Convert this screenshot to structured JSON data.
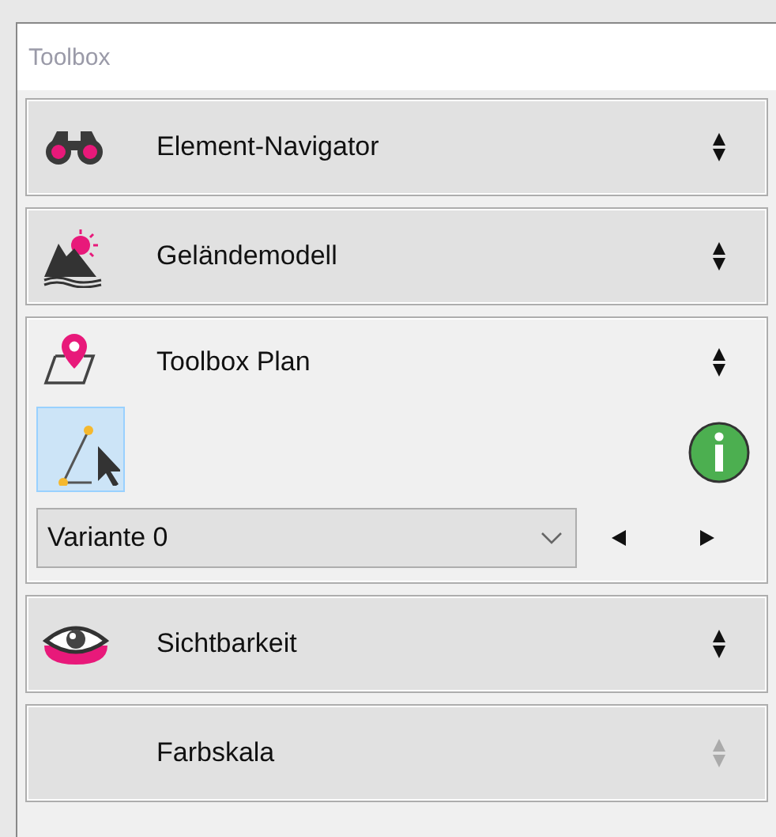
{
  "window": {
    "title": "Toolbox"
  },
  "panels": [
    {
      "title": "Element-Navigator",
      "expanded": false,
      "disabled": false
    },
    {
      "title": "Geländemodell",
      "expanded": false,
      "disabled": false
    },
    {
      "title": "Toolbox Plan",
      "expanded": true,
      "disabled": false,
      "tool": {
        "selected": true
      },
      "variant": {
        "value": "Variante 0"
      }
    },
    {
      "title": "Sichtbarkeit",
      "expanded": false,
      "disabled": false
    },
    {
      "title": "Farbskala",
      "expanded": false,
      "disabled": true
    }
  ]
}
